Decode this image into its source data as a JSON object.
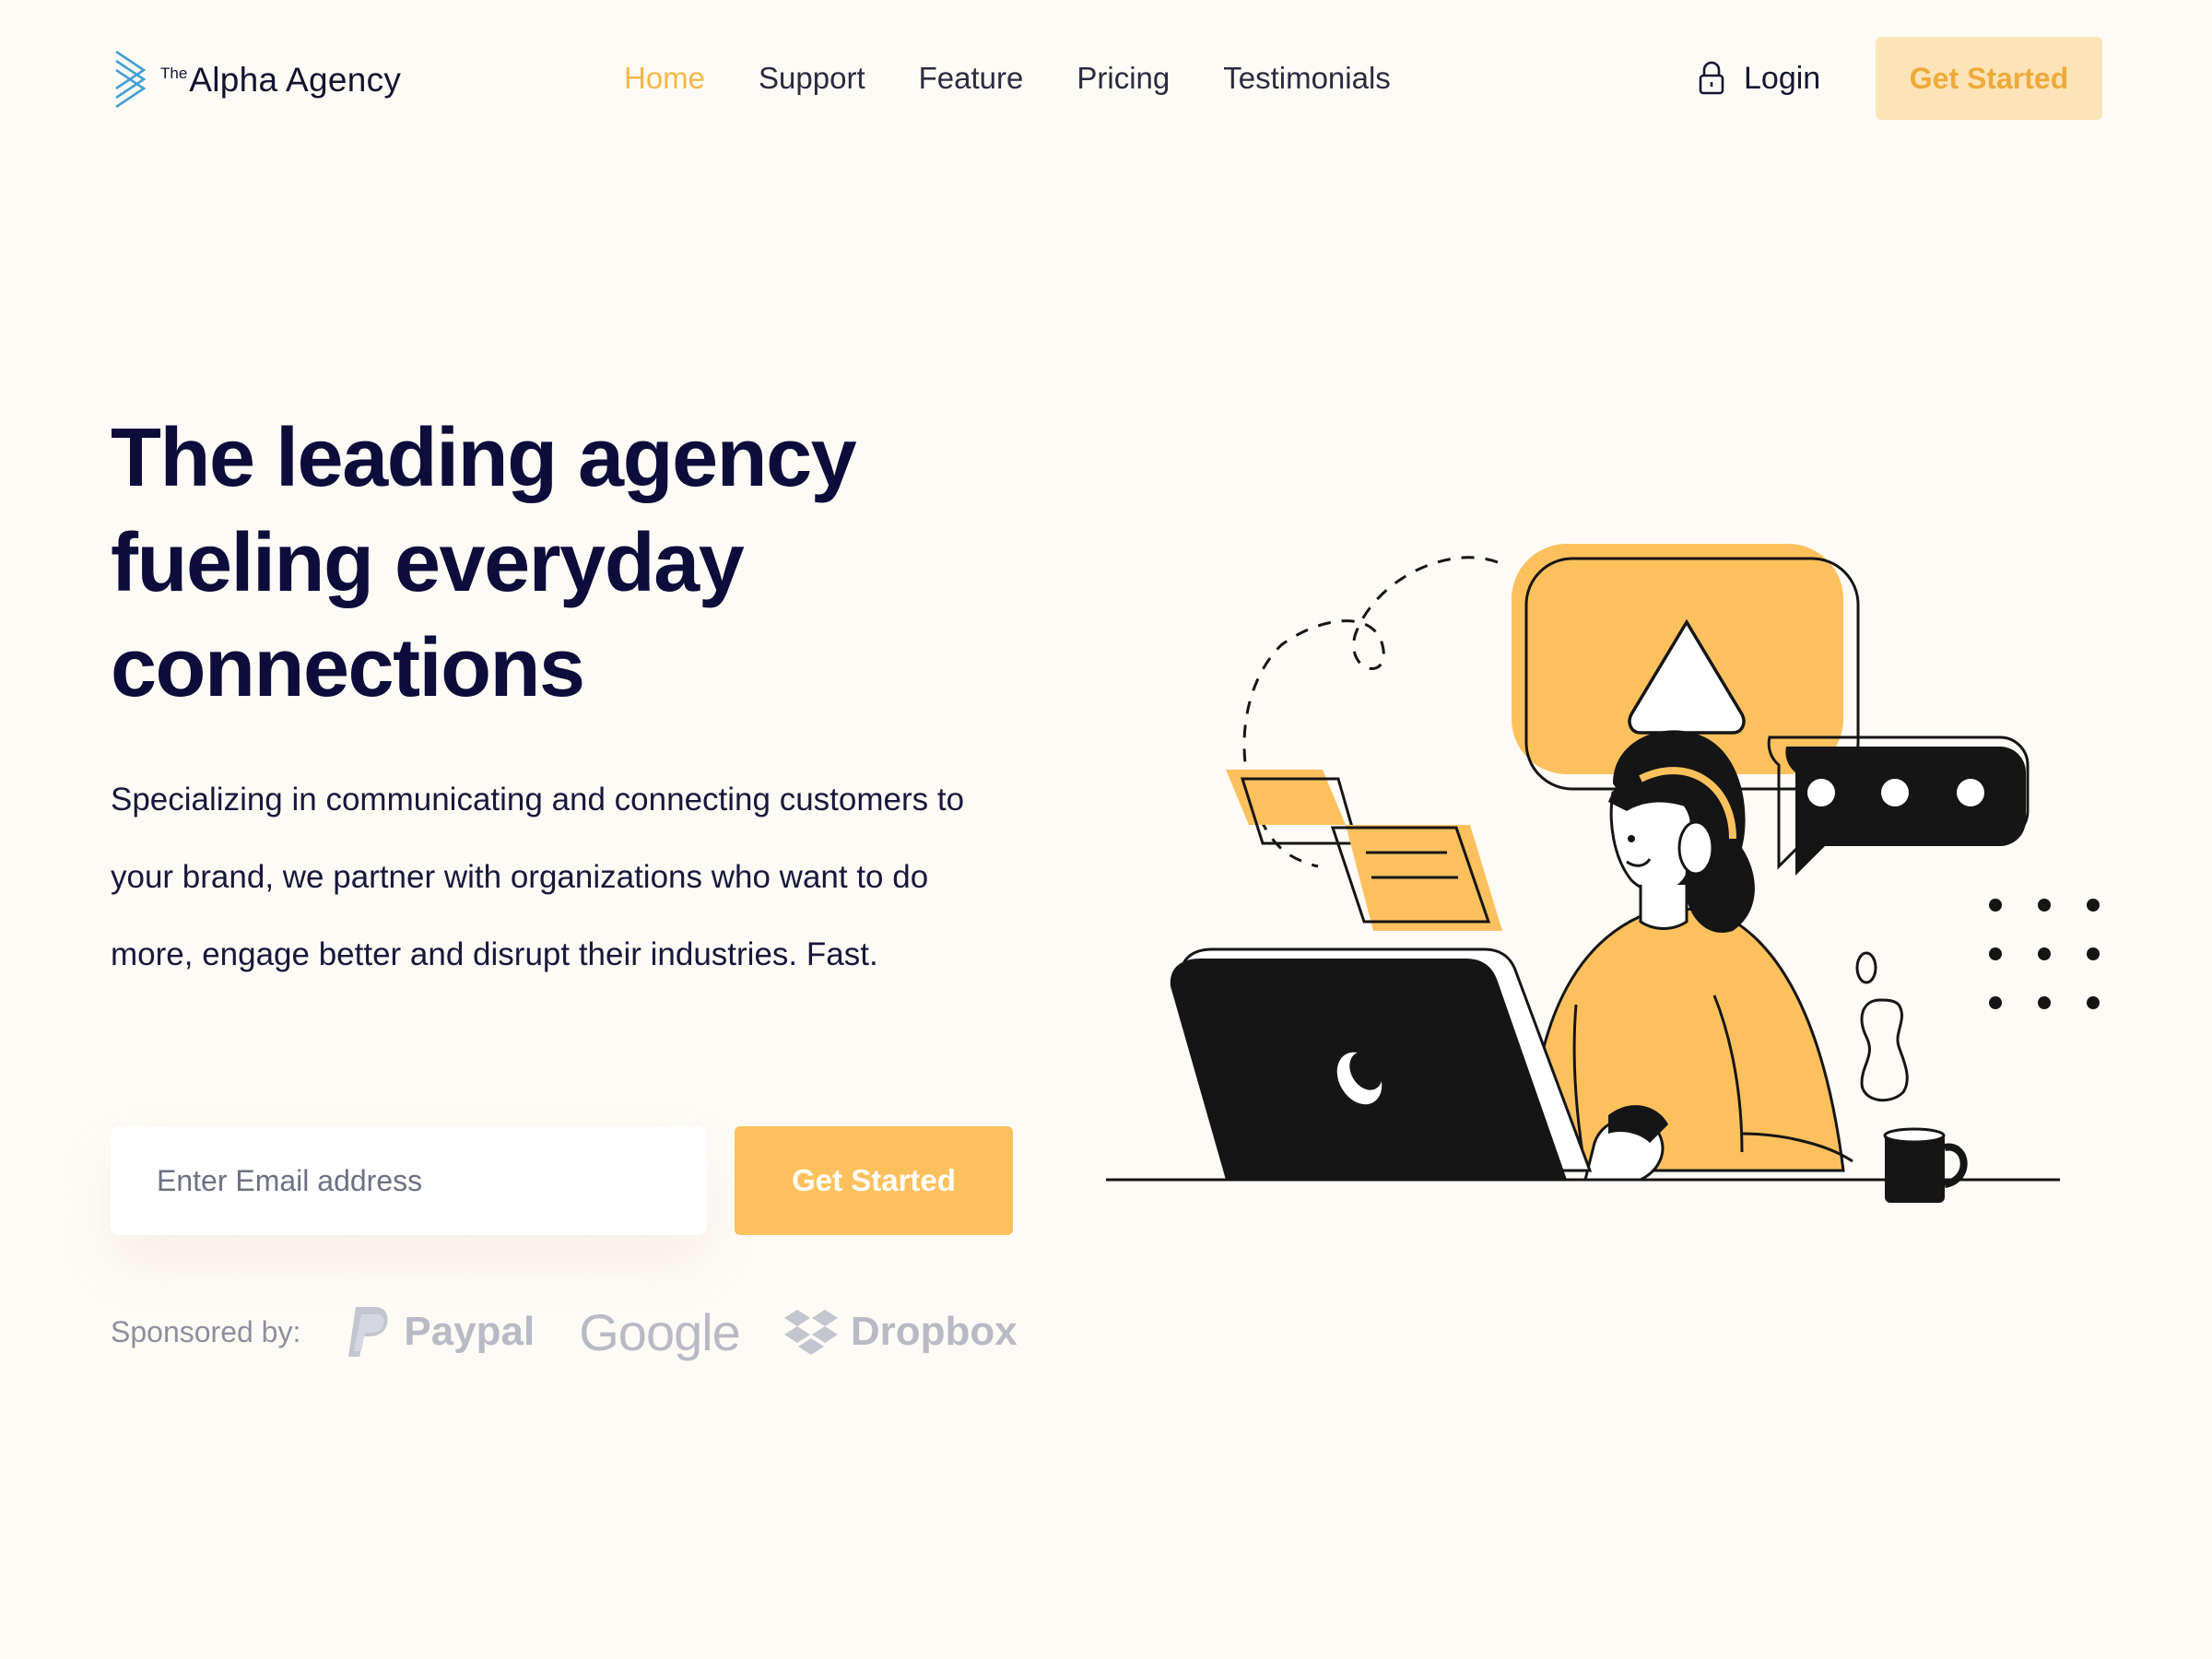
{
  "brand": {
    "prefix": "The",
    "name": "Alpha Agency",
    "logo_icon": "stacked-chevron-logo-icon",
    "colors": {
      "accent": "#f5b746",
      "accent_strong": "#fcc15d",
      "accent_soft": "#fde4b8",
      "ink": "#0c0d3a",
      "logo_blue": "#3f9fd6",
      "background": "#fefbf6"
    }
  },
  "nav": {
    "items": [
      {
        "label": "Home",
        "active": true
      },
      {
        "label": "Support",
        "active": false
      },
      {
        "label": "Feature",
        "active": false
      },
      {
        "label": "Pricing",
        "active": false
      },
      {
        "label": "Testimonials",
        "active": false
      }
    ],
    "login_label": "Login",
    "login_icon": "lock-icon",
    "cta_label": "Get Started"
  },
  "hero": {
    "title_lines": [
      "The leading agency",
      "fueling everyday",
      "connections"
    ],
    "description": "Specializing in communicating and connecting customers to your brand, we partner with organizations who want to do more, engage better and disrupt their industries. Fast.",
    "email_placeholder": "Enter Email address",
    "cta_label": "Get Started"
  },
  "sponsors": {
    "label": "Sponsored by:",
    "items": [
      {
        "name": "Paypal",
        "icon": "paypal-logo-icon"
      },
      {
        "name": "Google",
        "icon": ""
      },
      {
        "name": "Dropbox",
        "icon": "dropbox-logo-icon"
      }
    ]
  },
  "illustration": {
    "subject": "woman-with-headset-at-laptop-illustration"
  }
}
